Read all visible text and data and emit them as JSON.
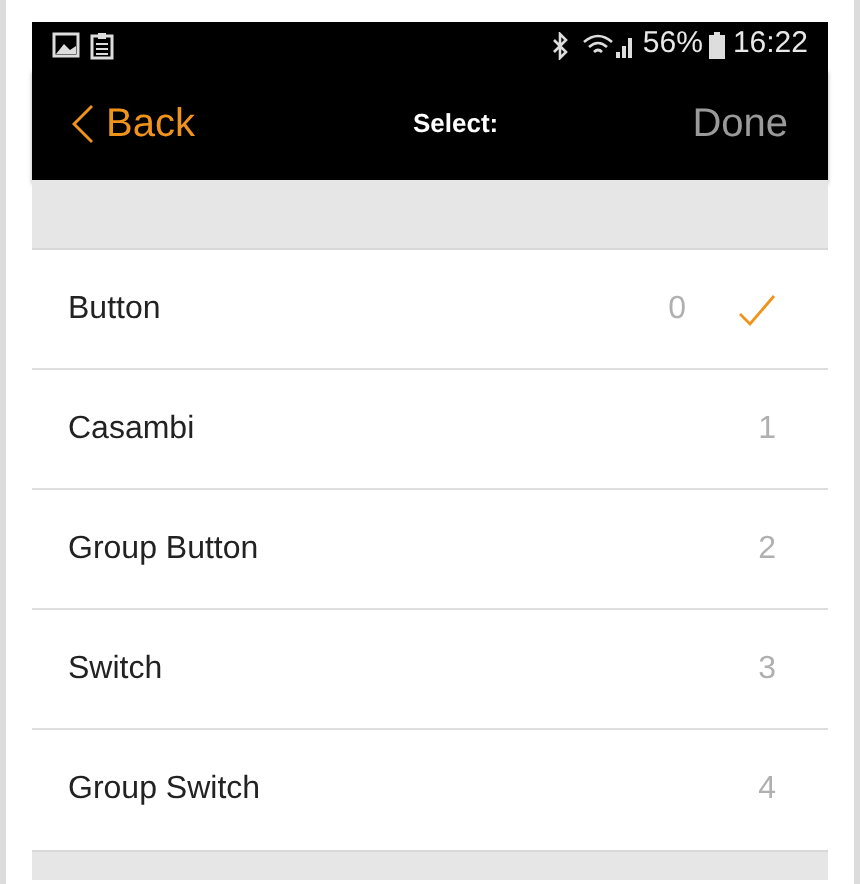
{
  "status_bar": {
    "battery": "56%",
    "time": "16:22"
  },
  "nav_bar": {
    "back": "Back",
    "title": "Select:",
    "done": "Done"
  },
  "options": [
    {
      "label": "Button",
      "value": "0",
      "selected": true
    },
    {
      "label": "Casambi",
      "value": "1",
      "selected": false
    },
    {
      "label": "Group Button",
      "value": "2",
      "selected": false
    },
    {
      "label": "Switch",
      "value": "3",
      "selected": false
    },
    {
      "label": "Group Switch",
      "value": "4",
      "selected": false
    }
  ]
}
